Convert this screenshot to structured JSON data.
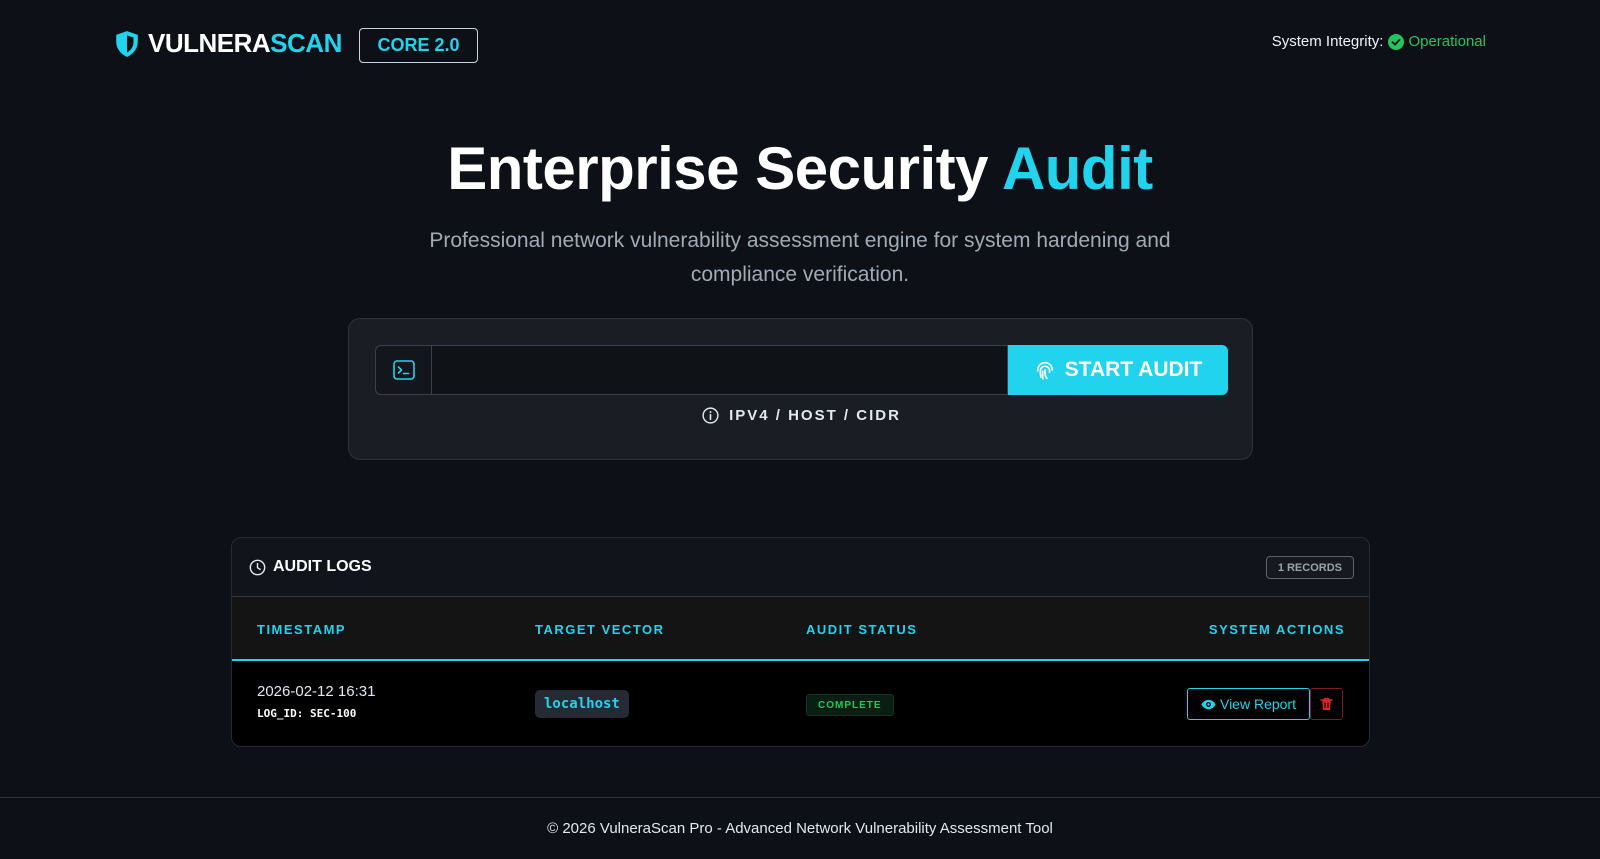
{
  "header": {
    "brand_primary": "VULNERA",
    "brand_accent": "SCAN",
    "version_badge": "CORE 2.0",
    "integrity_label": "System Integrity:",
    "integrity_value": "Operational"
  },
  "hero": {
    "title_primary": "Enterprise Security ",
    "title_accent": "Audit",
    "subtitle": "Professional network vulnerability assessment engine for system hardening and compliance verification."
  },
  "scan": {
    "input_value": "",
    "button_label": "START AUDIT",
    "hint": "IPV4 / HOST / CIDR"
  },
  "logs": {
    "title": "AUDIT LOGS",
    "records_badge": "1 RECORDS",
    "columns": [
      "TIMESTAMP",
      "TARGET VECTOR",
      "AUDIT STATUS",
      "SYSTEM ACTIONS"
    ],
    "rows": [
      {
        "timestamp": "2026-02-12 16:31",
        "log_id": "LOG_ID: SEC-100",
        "target": "localhost",
        "status": "COMPLETE",
        "view_label": "View Report"
      }
    ]
  },
  "footer": {
    "text": "© 2026 VulneraScan Pro - Advanced Network Vulnerability Assessment Tool"
  },
  "colors": {
    "accent": "#22d3ee",
    "success": "#22c55e",
    "danger": "#dc2626",
    "background": "#0d1117"
  },
  "icons": {
    "brand": "shield-icon",
    "integrity": "check-circle-icon",
    "input": "terminal-icon",
    "button": "fingerprint-icon",
    "hint": "info-icon",
    "logs": "clock-icon",
    "view": "eye-icon",
    "delete": "trash-icon"
  }
}
